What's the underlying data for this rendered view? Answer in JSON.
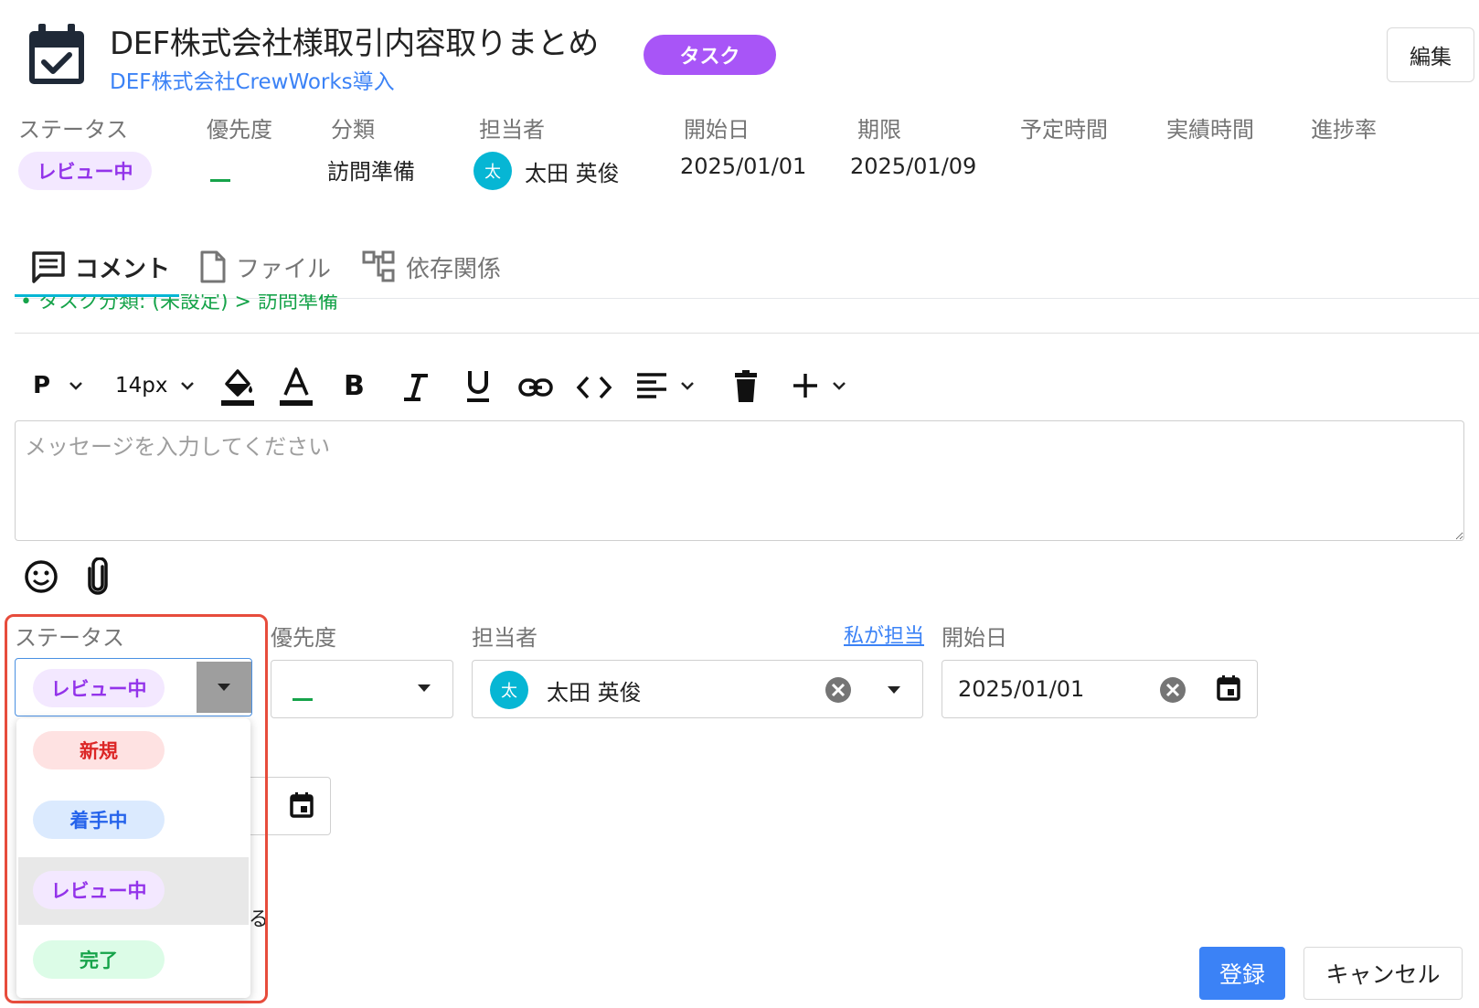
{
  "header": {
    "title": "DEF株式会社様取引内容取りまとめ",
    "type_badge": "タスク",
    "project_link": "DEF株式会社CrewWorks導入",
    "edit_label": "編集",
    "icon": "calendar-check-icon"
  },
  "meta": {
    "labels": {
      "status": "ステータス",
      "priority": "優先度",
      "category": "分類",
      "assignee": "担当者",
      "start_date": "開始日",
      "due_date": "期限",
      "planned_time": "予定時間",
      "actual_time": "実績時間",
      "progress": "進捗率"
    },
    "values": {
      "status": "レビュー中",
      "category": "訪問準備",
      "assignee": "太田 英俊",
      "assignee_initial": "太",
      "start_date": "2025/01/01",
      "due_date": "2025/01/09"
    }
  },
  "tabs": [
    {
      "label": "コメント",
      "icon": "comment-icon",
      "active": true
    },
    {
      "label": "ファイル",
      "icon": "file-icon",
      "active": false
    },
    {
      "label": "依存関係",
      "icon": "dependency-icon",
      "active": false
    }
  ],
  "partial_history": "• タスク分類: (未設定) > 訪問準備",
  "toolbar": {
    "paragraph": "P",
    "font_size": "14px",
    "icons": [
      "paragraph-icon",
      "fill-color-icon",
      "text-color-icon",
      "bold-icon",
      "italic-icon",
      "underline-icon",
      "link-icon",
      "code-icon",
      "align-icon",
      "delete-icon",
      "insert-icon"
    ]
  },
  "editor": {
    "placeholder": "メッセージを入力してください"
  },
  "form": {
    "labels": {
      "status": "ステータス",
      "priority": "優先度",
      "assignee": "担当者",
      "assign_me": "私が担当",
      "start_date": "開始日"
    },
    "status_value": "レビュー中",
    "assignee_value": "太田 英俊",
    "assignee_initial": "太",
    "start_date_value": "2025/01/01",
    "partial_glyph": "る",
    "status_options": [
      {
        "label": "新規",
        "color": "#dc2626",
        "selected": false
      },
      {
        "label": "着手中",
        "color": "#2563eb",
        "selected": false
      },
      {
        "label": "レビュー中",
        "color": "#9333ea",
        "selected": true
      },
      {
        "label": "完了",
        "color": "#16a34a",
        "selected": false
      }
    ]
  },
  "buttons": {
    "submit": "登録",
    "cancel": "キャンセル"
  },
  "colors": {
    "accent": "#3b82f6",
    "task_badge": "#a855f7",
    "highlight_border": "#e74c3c",
    "tab_underline": "#06b6d4"
  }
}
